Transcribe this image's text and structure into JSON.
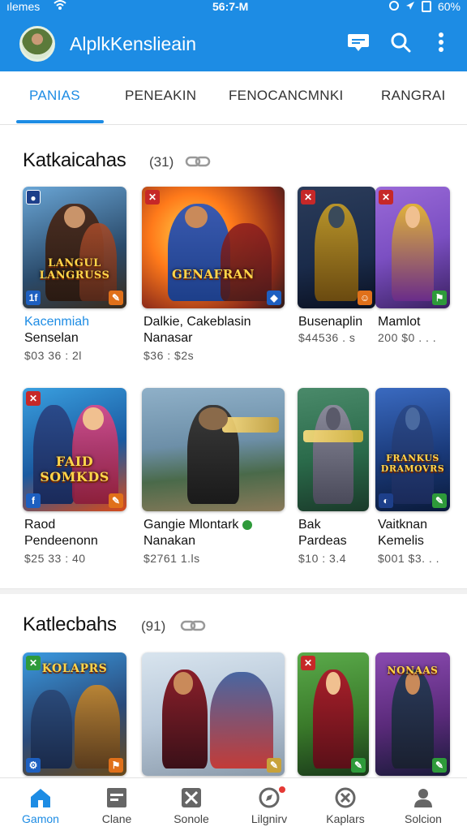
{
  "status_bar": {
    "carrier": "ılemes",
    "time": "56:7-M",
    "battery": "60%"
  },
  "app_bar": {
    "title": "AlplkKenslieain",
    "icons": [
      "chat-icon",
      "search-icon",
      "more-vert-icon"
    ]
  },
  "tabs": [
    {
      "label": "PANIAS",
      "active": true
    },
    {
      "label": "PENEAKIN",
      "active": false
    },
    {
      "label": "FENOCANCMNKI",
      "active": false
    },
    {
      "label": "RANGRAI",
      "active": false
    }
  ],
  "sections": [
    {
      "title": "Katkaicahas",
      "count": "(31)",
      "cards": [
        {
          "name_line1": "Kacenmiah",
          "name_line2": "Senselan",
          "price": "$03 36 : 2l",
          "logo": "LANGUL LANGRUSS",
          "accent": "#1d8ce4",
          "colors": [
            "#6aa6d6",
            "#4a2e22",
            "#a54b2a"
          ],
          "badge_left": "1f",
          "badge_right": "✎"
        },
        {
          "name_line1": "Dalkie, Cakeblasin",
          "name_line2": "Nanasar",
          "price": "$36 : $2s",
          "logo": "GENAFRAN",
          "colors": [
            "#ff7a1a",
            "#1d3f8a",
            "#8f1f1f"
          ],
          "badge_right": "◆"
        },
        {
          "name_line1": "Busenaplin",
          "name_line2": "",
          "price": "$44536 . s",
          "logo": "",
          "colors": [
            "#1a2b4a",
            "#8c6a1e",
            "#2b3c5a"
          ],
          "badge_right": "☺"
        },
        {
          "name_line1": "Mamlot",
          "name_line2": "",
          "price": "200 $0 . . .",
          "logo": "",
          "colors": [
            "#7b4fc2",
            "#e0b23a",
            "#6a2c8a"
          ],
          "badge_right": "⚑"
        }
      ]
    },
    {
      "row": 2,
      "cards": [
        {
          "name_line1": "Raod",
          "name_line2": "Pendeenonn",
          "price": "$25 33 : 40",
          "logo": "FAID SOMKDS",
          "colors": [
            "#3aa0e0",
            "#e04a8a",
            "#d84a1a"
          ],
          "badge_left": "f",
          "badge_right": "✎"
        },
        {
          "name_line1": "Gangie Mlontark",
          "name_line2": "Nanakan",
          "price": "$2761 1.ls",
          "logo": "",
          "colors": [
            "#6d8fa8",
            "#3a3a3a",
            "#c9a23a"
          ]
        },
        {
          "name_line1": "Bak",
          "name_line2": "Pardeas",
          "price": "$10 : 3.4",
          "logo": "",
          "colors": [
            "#2a6a4a",
            "#6a6a7a",
            "#d8b83a"
          ]
        },
        {
          "name_line1": "Vaitknan",
          "name_line2": "Kemelis",
          "price": "$001 $3. . .",
          "logo": "FRANKUS DRAMOVRS",
          "colors": [
            "#1a3a7a",
            "#2a4a8a",
            "#c98a2a"
          ],
          "badge_left": "◐",
          "badge_right": "✎"
        }
      ]
    },
    {
      "title": "Katlecbahs",
      "count": "(91)",
      "cards": [
        {
          "logo": "KOLAPRS",
          "colors": [
            "#3a9ae0",
            "#2a4a7a",
            "#c8882a"
          ],
          "badge_left": "⚙",
          "badge_right": "⚑"
        },
        {
          "logo": "",
          "colors": [
            "#b7c7d8",
            "#8a1f2a",
            "#3a5a9a"
          ],
          "badge_right": "✎"
        },
        {
          "logo": "",
          "colors": [
            "#3a7a2a",
            "#a81f2a",
            "#c89a2a"
          ],
          "badge_right": "✎"
        },
        {
          "logo": "NONAAS",
          "colors": [
            "#5a2a7a",
            "#2a3a5a",
            "#c8a23a"
          ],
          "badge_right": "✎"
        }
      ]
    }
  ],
  "bottom_nav": [
    {
      "label": "Gamon",
      "icon": "home-icon",
      "active": true
    },
    {
      "label": "Clane",
      "icon": "chat-box-icon",
      "active": false
    },
    {
      "label": "Sonole",
      "icon": "crossed-swords-icon",
      "active": false
    },
    {
      "label": "Lilgnirv",
      "icon": "compass-icon",
      "active": false,
      "notification": true
    },
    {
      "label": "Kaplars",
      "icon": "close-circle-icon",
      "active": false
    },
    {
      "label": "Solcion",
      "icon": "user-icon",
      "active": false
    }
  ]
}
